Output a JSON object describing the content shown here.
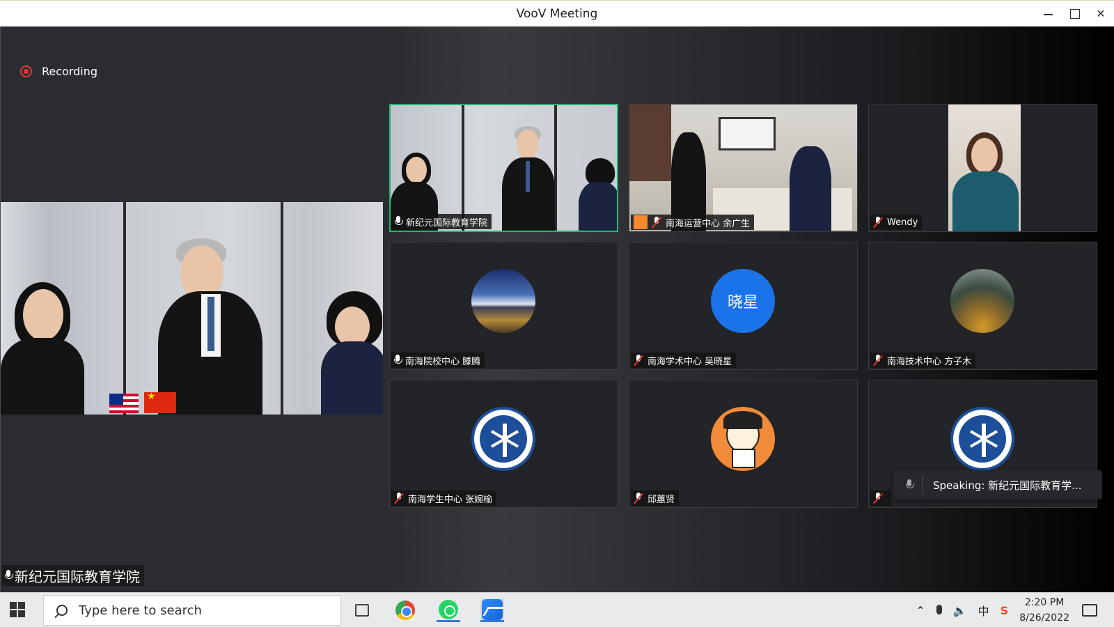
{
  "window": {
    "title": "VooV Meeting"
  },
  "recording": {
    "label": "Recording"
  },
  "main_speaker": {
    "name": "新纪元国际教育学院"
  },
  "tiles": [
    {
      "name": "新纪元国际教育学院",
      "mic": "on",
      "active": true
    },
    {
      "name": "南海运营中心 余广生",
      "mic": "muted"
    },
    {
      "name": "Wendy",
      "mic": "muted"
    },
    {
      "name": "南海院校中心 滕腾",
      "mic": "on"
    },
    {
      "name": "南海学术中心 吴晓星",
      "mic": "muted",
      "avatar_text": "晓星"
    },
    {
      "name": "南海技术中心 方子木",
      "mic": "muted"
    },
    {
      "name": "南海学生中心 张婉榆",
      "mic": "muted"
    },
    {
      "name": "邱蕙贤",
      "mic": "muted"
    },
    {
      "name": "",
      "mic": "muted"
    }
  ],
  "speaking": {
    "text": "Speaking: 新纪元国际教育学..."
  },
  "ime": {
    "logo": "S",
    "lang": "中",
    "punct": "°,",
    "mic": "mic-icon",
    "keyboard": "keyboard-icon",
    "skin": "shirt-icon",
    "grid": "grid-icon"
  },
  "taskbar": {
    "search_placeholder": "Type here to search",
    "tray_lang": "中",
    "time": "2:20 PM",
    "date": "8/26/2022"
  },
  "colors": {
    "active_border": "#22b573",
    "record_red": "#e53935",
    "avatar_blue": "#1a73e8"
  }
}
